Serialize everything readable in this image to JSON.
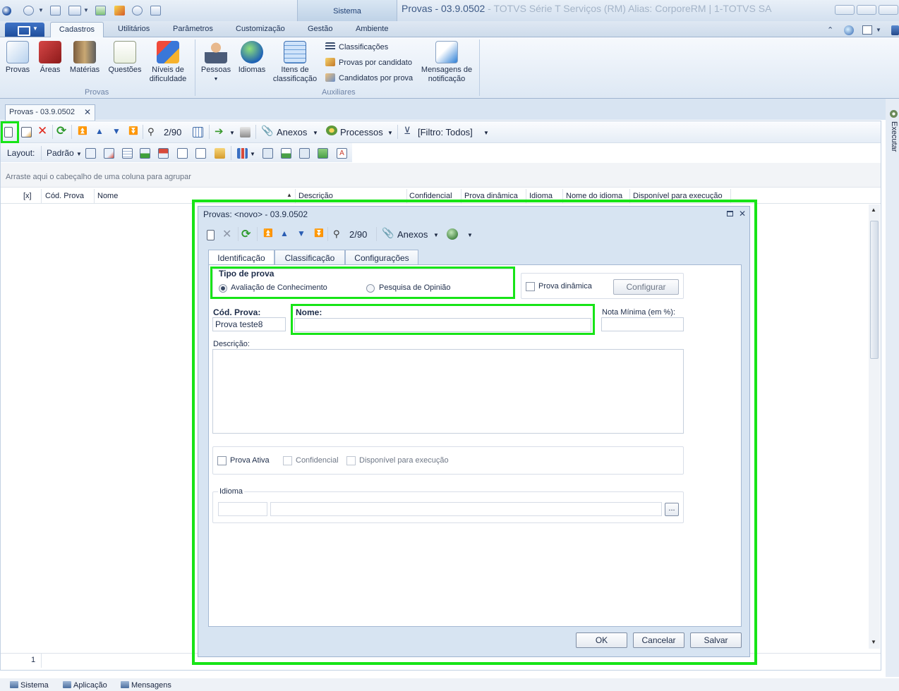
{
  "window": {
    "title": "Provas - 03.9.0502",
    "title_dim": " - TOTVS Série T Serviços (RM) Alias: CorporeRM | 1-TOTVS SA",
    "context_tab_group": "Sistema"
  },
  "ribbon": {
    "tabs": [
      "Cadastros",
      "Utilitários",
      "Parâmetros",
      "Customização",
      "Gestão",
      "Ambiente"
    ],
    "groups": {
      "provas": {
        "label": "Provas",
        "buttons": [
          "Provas",
          "Áreas",
          "Matérias",
          "Questões",
          "Níveis de dificuldade"
        ]
      },
      "auxiliares": {
        "label": "Auxiliares",
        "buttons": [
          "Pessoas",
          "Idiomas",
          "Itens de classificação"
        ],
        "small_buttons": [
          "Classificações",
          "Provas por candidato",
          "Candidatos por prova"
        ],
        "mensagens": "Mensagens de notificação"
      }
    }
  },
  "document_tab": {
    "label": "Provas - 03.9.0502",
    "close": "✕"
  },
  "toolbar": {
    "record_position": "2/90",
    "anexos": "Anexos",
    "processos": "Processos",
    "filtro": "[Filtro: Todos]"
  },
  "layout_bar": {
    "label": "Layout:",
    "preset": "Padrão"
  },
  "grid": {
    "group_hint": "Arraste aqui o cabeçalho de uma coluna para agrupar",
    "columns": [
      "[x]",
      "Cód. Prova",
      "Nome",
      "Descrição",
      "Confidencial",
      "Prova dinâmica",
      "Idioma",
      "Nome do idioma",
      "Disponível para execução"
    ],
    "footer_count": "1"
  },
  "side_panel": {
    "label": "Executar"
  },
  "status_bar": {
    "items": [
      "Sistema",
      "Aplicação",
      "Mensagens"
    ]
  },
  "modal": {
    "title": "Provas: <novo> - 03.9.0502",
    "toolbar": {
      "record_position": "2/90",
      "anexos": "Anexos"
    },
    "tabs": [
      "Identificação",
      "Classificação",
      "Configurações"
    ],
    "tipo_prova": {
      "label": "Tipo de prova",
      "options": [
        "Avaliação de Conhecimento",
        "Pesquisa de Opinião"
      ],
      "selected": "Avaliação de Conhecimento"
    },
    "prova_dinamica_label": "Prova dinâmica",
    "configurar_label": "Configurar",
    "cod_prova": {
      "label": "Cód. Prova:",
      "value": "Prova teste8"
    },
    "nome": {
      "label": "Nome:",
      "value": ""
    },
    "nota_minima": {
      "label": "Nota Mínima (em %):",
      "value": ""
    },
    "descricao": {
      "label": "Descrição:",
      "value": ""
    },
    "checkboxes": [
      "Prova Ativa",
      "Confidencial",
      "Disponível para execução"
    ],
    "idioma": {
      "label": "Idioma",
      "code": "",
      "name": "",
      "lookup": "..."
    },
    "buttons": {
      "ok": "OK",
      "cancel": "Cancelar",
      "save": "Salvar"
    }
  }
}
